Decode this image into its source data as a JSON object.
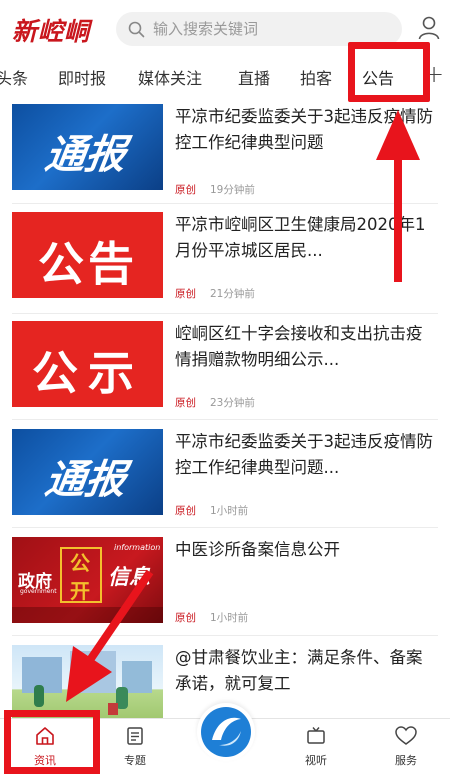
{
  "header": {
    "logo": "新崆峒",
    "search_placeholder": "输入搜索关键词"
  },
  "tabs": [
    {
      "label": "头条"
    },
    {
      "label": "即时报"
    },
    {
      "label": "媒体关注"
    },
    {
      "label": "直播"
    },
    {
      "label": "拍客"
    },
    {
      "label": "公告"
    }
  ],
  "news": [
    {
      "title": "平凉市纪委监委关于3起违反疫情防控工作纪律典型问题",
      "tag": "原创",
      "time": "19分钟前",
      "thumb_text": "通报"
    },
    {
      "title": "平凉市崆峒区卫生健康局2020年1月份平凉城区居民...",
      "tag": "原创",
      "time": "21分钟前",
      "thumb_text": "公告"
    },
    {
      "title": "崆峒区红十字会接收和支出抗击疫情捐赠款物明细公示...",
      "tag": "原创",
      "time": "23分钟前",
      "thumb_text": "公示"
    },
    {
      "title": "平凉市纪委监委关于3起违反疫情防控工作纪律典型问题...",
      "tag": "原创",
      "time": "1小时前",
      "thumb_text": "通报"
    },
    {
      "title": "中医诊所备案信息公开",
      "tag": "原创",
      "time": "1小时前",
      "thumb_text": "政府公开信息"
    },
    {
      "title": "@甘肃餐饮业主：满足条件、备案承诺，就可复工",
      "tag": "",
      "time": "",
      "thumb_text": ""
    }
  ],
  "thumb_extra": {
    "info_en": "information",
    "gov_en": "government",
    "gov": "政府",
    "gong": "公",
    "kai": "开",
    "xinxi": "信息"
  },
  "bottom_nav": [
    {
      "label": "资讯",
      "icon": "home-icon"
    },
    {
      "label": "专题",
      "icon": "document-icon"
    },
    {
      "label": "",
      "icon": "app-logo-icon"
    },
    {
      "label": "视听",
      "icon": "tv-icon"
    },
    {
      "label": "服务",
      "icon": "heart-icon"
    }
  ],
  "colors": {
    "brand_red": "#c9161d",
    "annotation_red": "#e8141c"
  }
}
